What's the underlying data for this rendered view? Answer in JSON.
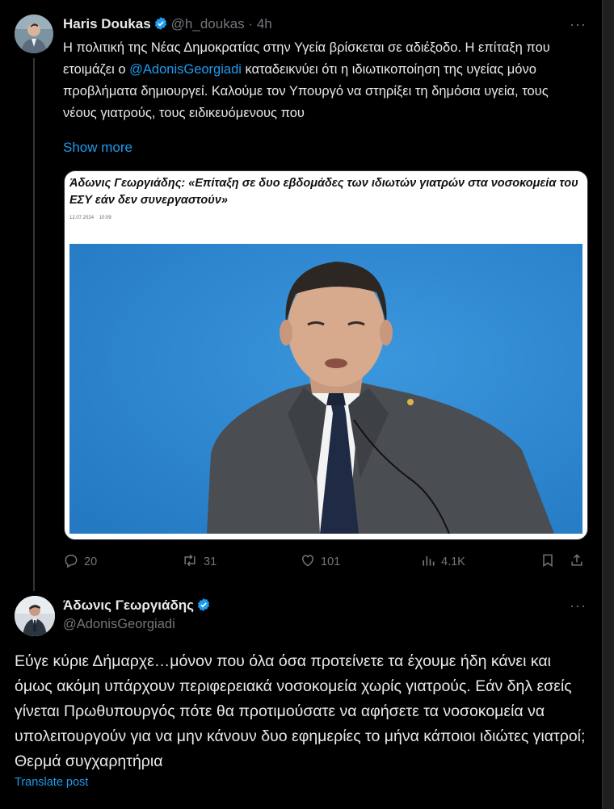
{
  "tweet1": {
    "author_name": "Haris Doukas",
    "handle": "@h_doukas",
    "separator": "·",
    "time": "4h",
    "more": "···",
    "text_before_mention": "Η πολιτική της Νέας Δημοκρατίας στην Υγεία βρίσκεται σε αδιέξοδο. Η επίταξη που ετοιμάζει ο ",
    "mention": "@AdonisGeorgiadi",
    "text_after_mention": " καταδεικνύει ότι η ιδιωτικοποίηση της υγείας μόνο προβλήματα δημιουργεί. Καλούμε τον Υπουργό να στηρίξει τη δημόσια υγεία, τους νέους γιατρούς, τους ειδικευόμενους που",
    "show_more": "Show more",
    "card": {
      "headline": "Άδωνις Γεωργιάδης: «Επίταξη σε δυο εβδομάδες των ιδιωτών γιατρών στα νοσοκομεία του ΕΣΥ εάν δεν συνεργαστούν»",
      "date": "12.07.2024",
      "time": "10:09"
    },
    "actions": {
      "replies": "20",
      "reposts": "31",
      "likes": "101",
      "views": "4.1K"
    }
  },
  "tweet2": {
    "author_name": "Άδωνις Γεωργιάδης",
    "handle": "@AdonisGeorgiadi",
    "more": "···",
    "text": "Εύγε κύριε Δήμαρχε…μόνον που όλα όσα προτείνετε τα έχουμε ήδη κάνει και όμως ακόμη υπάρχουν περιφερειακά νοσοκομεία χωρίς γιατρούς. Εάν δηλ εσείς γίνεται Πρωθυπουργός πότε θα προτιμούσατε να αφήσετε τα νοσοκομεία να υπολειτουργούν για να μην κάνουν δυο εφημερίες το μήνα κάποιοι ιδιώτες γιατροί; Θερμά συγχαρητήρια",
    "translate": "Translate post"
  },
  "colors": {
    "accent": "#1d9bf0",
    "background": "#000000",
    "muted": "#71767b",
    "text": "#e7e9ea"
  }
}
